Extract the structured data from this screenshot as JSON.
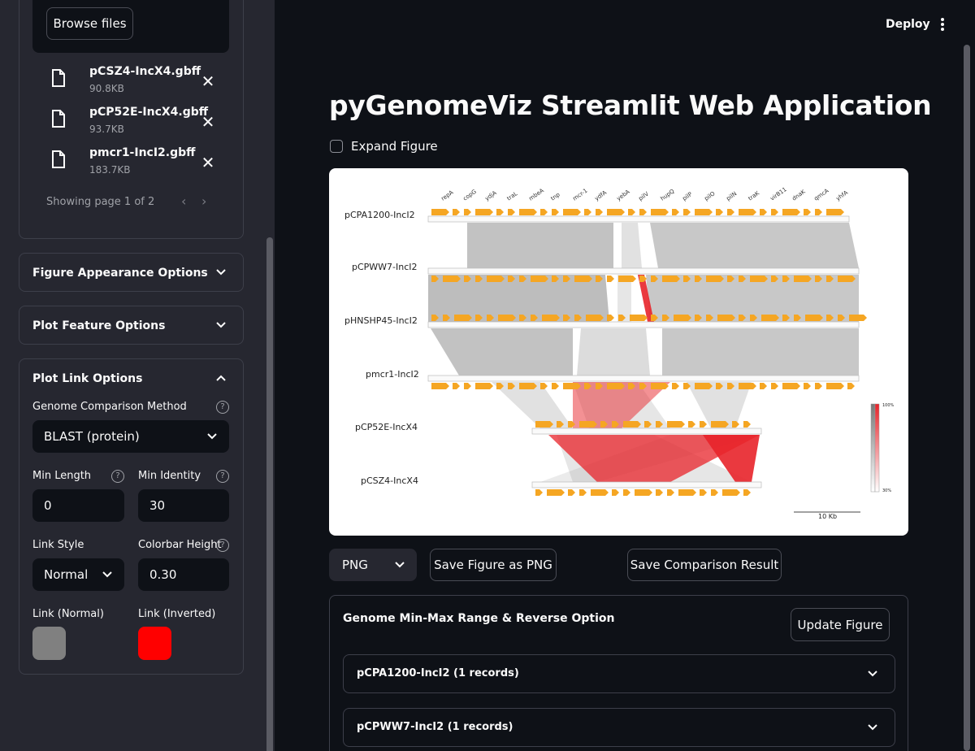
{
  "sidebar": {
    "browse_label": "Browse files",
    "files": [
      {
        "name": "pCSZ4-IncX4.gbff",
        "size": "90.8KB"
      },
      {
        "name": "pCP52E-IncX4.gbff",
        "size": "93.7KB"
      },
      {
        "name": "pmcr1-IncI2.gbff",
        "size": "183.7KB"
      }
    ],
    "remove_glyph": "✕",
    "page_info": "Showing page 1 of 2",
    "prev_glyph": "‹",
    "next_glyph": "›",
    "expanders": {
      "figure_appearance": "Figure Appearance Options",
      "plot_feature": "Plot Feature Options",
      "plot_link": "Plot Link Options"
    },
    "link_options": {
      "method_label": "Genome Comparison Method",
      "method_value": "BLAST (protein)",
      "min_length_label": "Min Length",
      "min_length_value": "0",
      "min_identity_label": "Min Identity",
      "min_identity_value": "30",
      "link_style_label": "Link Style",
      "link_style_value": "Normal",
      "colorbar_height_label": "Colorbar Height",
      "colorbar_height_value": "0.30",
      "link_normal_label": "Link (Normal)",
      "link_normal_color": "#808080",
      "link_inverted_label": "Link (Inverted)",
      "link_inverted_color": "#ff0000"
    }
  },
  "header": {
    "deploy_label": "Deploy"
  },
  "main": {
    "title": "pyGenomeViz Streamlit Web Application",
    "expand_figure_label": "Expand Figure",
    "figure": {
      "genomes": [
        "pCPA1200-IncI2",
        "pCPWW7-IncI2",
        "pHNSHP45-IncI2",
        "pmcr1-IncI2",
        "pCP52E-IncX4",
        "pCSZ4-IncX4"
      ],
      "scalebar_label": "10 Kb",
      "colorbar_max": "100%",
      "colorbar_min": "30%",
      "feature_color": "#f5a623",
      "link_color": "#9a9a9a",
      "inverted_link_color": "#e8232a",
      "top_labels": [
        "repA",
        "copG",
        "ydjA",
        "traL",
        "mbeA",
        "tnp",
        "mcr-1",
        "ydfA",
        "yebA",
        "pilV",
        "hupQ",
        "pilP",
        "pilO",
        "pilN",
        "traK",
        "virB11",
        "dnaK",
        "qmcA",
        "yhfA"
      ]
    },
    "format_value": "PNG",
    "save_figure_label": "Save Figure as PNG",
    "save_comparison_label": "Save Comparison Result",
    "range_panel": {
      "title": "Genome Min-Max Range & Reverse Option",
      "update_label": "Update Figure",
      "items": [
        "pCPA1200-IncI2 (1 records)",
        "pCPWW7-IncI2 (1 records)"
      ]
    }
  }
}
